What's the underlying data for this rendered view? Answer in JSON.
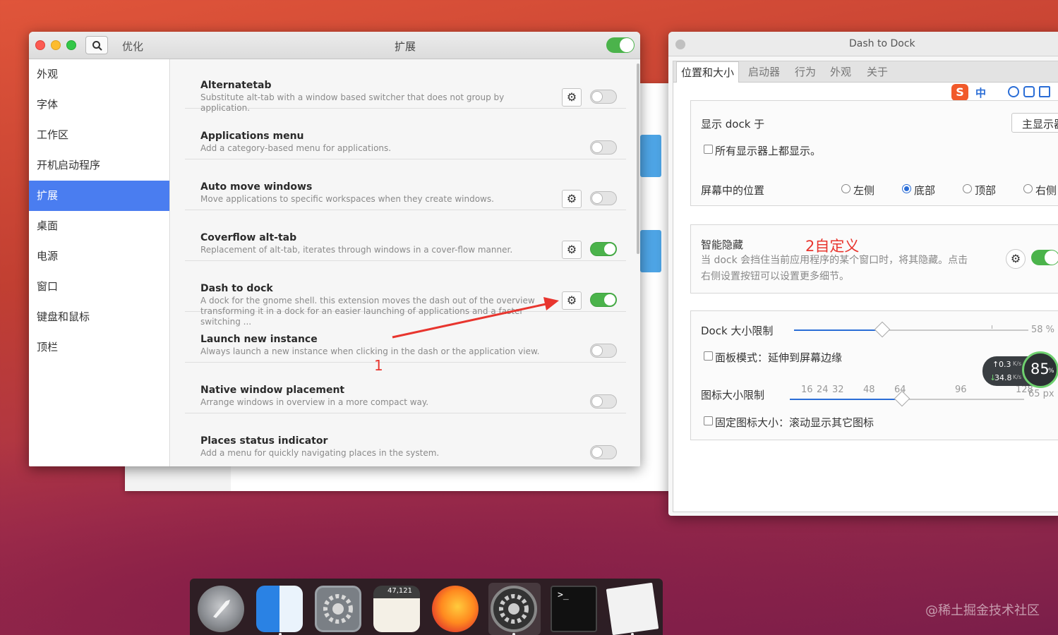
{
  "tweaks": {
    "app_title": "优化",
    "window_title": "扩展",
    "sidebar": [
      {
        "label": "外观",
        "active": false
      },
      {
        "label": "字体",
        "active": false
      },
      {
        "label": "工作区",
        "active": false
      },
      {
        "label": "开机启动程序",
        "active": false
      },
      {
        "label": "扩展",
        "active": true
      },
      {
        "label": "桌面",
        "active": false
      },
      {
        "label": "电源",
        "active": false
      },
      {
        "label": "窗口",
        "active": false
      },
      {
        "label": "键盘和鼠标",
        "active": false
      },
      {
        "label": "顶栏",
        "active": false
      }
    ],
    "extensions": [
      {
        "name": "Alternatetab",
        "desc": "Substitute alt-tab with a window based switcher that does not group by application.",
        "has_settings": true,
        "enabled": false
      },
      {
        "name": "Applications menu",
        "desc": "Add a category-based menu for applications.",
        "has_settings": false,
        "enabled": false
      },
      {
        "name": "Auto move windows",
        "desc": "Move applications to specific workspaces when they create windows.",
        "has_settings": true,
        "enabled": false
      },
      {
        "name": "Coverflow alt-tab",
        "desc": "Replacement of alt-tab, iterates through windows in a cover-flow manner.",
        "has_settings": true,
        "enabled": true
      },
      {
        "name": "Dash to dock",
        "desc": "A dock for the gnome shell. this extension moves the dash out of the overview transforming it in a dock for an easier launching of applications and a faster switching ...",
        "has_settings": true,
        "enabled": true
      },
      {
        "name": "Launch new instance",
        "desc": "Always launch a new instance when clicking in the dash or the application view.",
        "has_settings": false,
        "enabled": false
      },
      {
        "name": "Native window placement",
        "desc": "Arrange windows in overview in a more compact way.",
        "has_settings": false,
        "enabled": false
      },
      {
        "name": "Places status indicator",
        "desc": "Add a menu for quickly navigating places in the system.",
        "has_settings": false,
        "enabled": false
      }
    ],
    "annotation_1": "1"
  },
  "dtd": {
    "title": "Dash to Dock",
    "tabs": [
      "位置和大小",
      "启动器",
      "行为",
      "外观",
      "关于"
    ],
    "ime": {
      "logo": "S",
      "zh": "中"
    },
    "show_dock_on_label": "显示 dock 于",
    "monitor_value": "主显示器",
    "all_monitors_label": "所有显示器上都显示。",
    "position_label": "屏幕中的位置",
    "positions": [
      {
        "label": "左侧",
        "selected": false
      },
      {
        "label": "底部",
        "selected": true
      },
      {
        "label": "顶部",
        "selected": false
      },
      {
        "label": "右侧",
        "selected": false
      }
    ],
    "intellihide_label": "智能隐藏",
    "annotation_2": "2自定义",
    "intellihide_desc_1": "当 dock 会挡住当前应用程序的某个窗口时，将其隐藏。点击",
    "intellihide_desc_2": "右侧设置按钮可以设置更多细节。",
    "dock_size_label": "Dock 大小限制",
    "dock_size_value": "58 %",
    "dock_size_fraction": 0.58,
    "panel_mode_label": "面板模式：延伸到屏幕边缘",
    "icon_size_label": "图标大小限制",
    "icon_size_ticks": [
      "16",
      "24",
      "32",
      "48",
      "64",
      "96",
      "128"
    ],
    "icon_size_value": "65 px",
    "fixed_icon_label": "固定图标大小：滚动显示其它图标"
  },
  "netmon": {
    "up": "0.3",
    "up_unit": "K/s",
    "down": "34.8",
    "down_unit": "K/s",
    "percent": "85",
    "pct_sign": "%"
  },
  "dock": {
    "items": [
      "launchpad",
      "finder",
      "system-preferences",
      "calculator",
      "firefox",
      "settings",
      "terminal",
      "text-editor"
    ],
    "calculator_label": "47,121"
  },
  "watermark": "@稀土掘金技术社区",
  "colors": {
    "accent": "#4a7df0",
    "switch_on": "#4bb34b",
    "annotation": "#e8352e"
  }
}
